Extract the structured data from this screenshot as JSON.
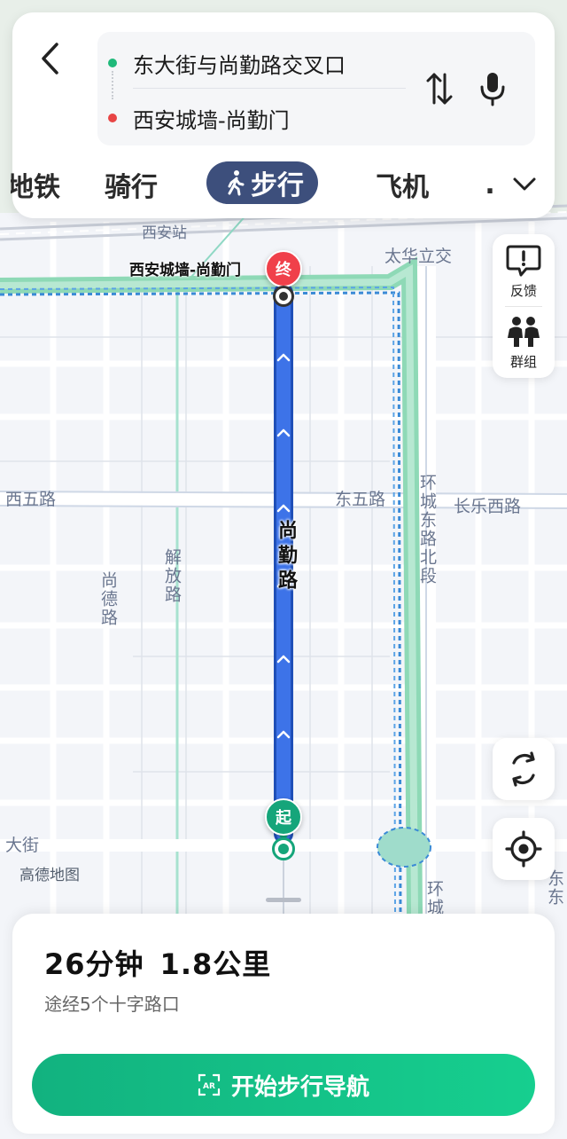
{
  "route": {
    "start": "东大街与尚勤路交叉口",
    "end": "西安城墙-尚勤门",
    "colors": {
      "start_dot": "#1fb97a",
      "end_dot": "#e84545"
    }
  },
  "modes": {
    "subway": "地铁",
    "bike": "骑行",
    "walk": "步行",
    "plane": "飞机",
    "active": "walk",
    "active_color": "#3d4f7c"
  },
  "tools": {
    "feedback": "反馈",
    "group": "群组"
  },
  "map": {
    "labels": {
      "station": "西安站",
      "taihua": "太华立交",
      "xiwu": "西五路",
      "dongwu": "东五路",
      "changle": "长乐西路",
      "huancheng_north": "环城东路北段",
      "jiefang": "解放路",
      "shangde": "尚德路",
      "dajie": "大街",
      "huancheng": "环城",
      "dong": "东东"
    },
    "destination_label": "西安城墙-尚勤门",
    "route_road": "尚勤路",
    "watermark": "高德地图",
    "markers": {
      "end": "终",
      "start": "起"
    },
    "route_color": "#3d73e8"
  },
  "summary": {
    "time": "26分钟",
    "distance": "1.8公里",
    "via": "途经5个十字路口"
  },
  "actions": {
    "start_nav": "开始步行导航",
    "ar_icon_text": "AR"
  }
}
